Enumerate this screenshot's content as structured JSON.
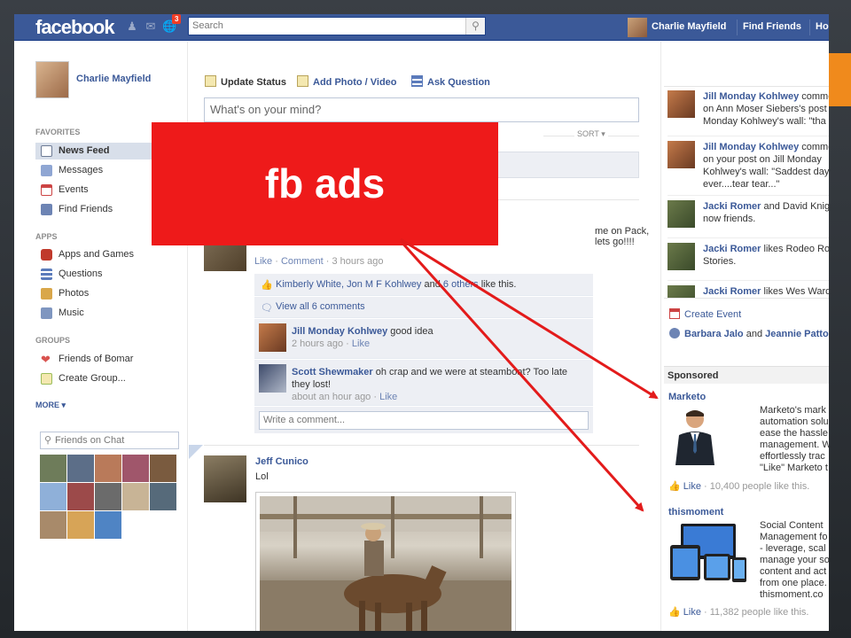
{
  "header": {
    "logo": "facebook",
    "notification_count": "3",
    "search_placeholder": "Search",
    "user_name": "Charlie Mayfield",
    "find_friends": "Find Friends",
    "home_partial": "Ho"
  },
  "left": {
    "profile_name": "Charlie Mayfield",
    "favorites_title": "FAVORITES",
    "favorites": [
      {
        "label": "News Feed",
        "icon": "news-feed-icon"
      },
      {
        "label": "Messages",
        "icon": "messages-icon"
      },
      {
        "label": "Events",
        "icon": "events-icon"
      },
      {
        "label": "Find Friends",
        "icon": "find-friends-icon"
      }
    ],
    "apps_title": "APPS",
    "apps": [
      {
        "label": "Apps and Games",
        "icon": "apps-icon"
      },
      {
        "label": "Questions",
        "icon": "questions-icon"
      },
      {
        "label": "Photos",
        "icon": "photos-icon"
      },
      {
        "label": "Music",
        "icon": "music-icon"
      }
    ],
    "groups_title": "GROUPS",
    "groups": [
      {
        "label": "Friends of Bomar",
        "icon": "heart-icon"
      },
      {
        "label": "Create Group...",
        "icon": "create-group-icon"
      }
    ],
    "more": "MORE",
    "chat_placeholder": "Friends on Chat"
  },
  "composer": {
    "update_status": "Update Status",
    "add_photo": "Add Photo / Video",
    "ask_question": "Ask Question",
    "placeholder": "What's on your mind?",
    "sort": "SORT"
  },
  "post1": {
    "text_tail": "me on Pack, lets go!!!!",
    "like": "Like",
    "comment": "Comment",
    "time": "3 hours ago",
    "likes_line": {
      "names": "Kimberly White, Jon M F Kohlwey",
      "and": "and",
      "others": "6 others",
      "suffix": "like this."
    },
    "view_comments": "View all 6 comments",
    "comments": [
      {
        "name": "Jill Monday Kohlwey",
        "text": "good idea",
        "time": "2 hours ago",
        "like": "Like"
      },
      {
        "name": "Scott Shewmaker",
        "text": "oh crap and we were at steamboat? Too late they lost!",
        "time": "about an hour ago",
        "like": "Like"
      }
    ],
    "write_placeholder": "Write a comment..."
  },
  "post2": {
    "name": "Jeff Cunico",
    "text": "Lol"
  },
  "ticker": [
    {
      "name": "Jill Monday Kohlwey",
      "rest": "comme",
      "line2": "on Ann Moser Siebers's post",
      "line3": "Monday Kohlwey's wall: \"tha"
    },
    {
      "name": "Jill Monday Kohlwey",
      "rest": "comme",
      "line2": "on your post on Jill Monday",
      "line3": "Kohlwey's wall: \"Saddest day",
      "line4": "ever....tear tear...\""
    },
    {
      "name": "Jacki Romer",
      "rest": "and David Knig",
      "line2": "now friends.",
      "line3": ""
    },
    {
      "name": "Jacki Romer",
      "rest": "likes Rodeo Roa",
      "line2": "Stories.",
      "line3": ""
    },
    {
      "name": "Jacki Romer",
      "rest": "likes Wes Ward",
      "line2": "",
      "line3": ""
    }
  ],
  "events": {
    "create_event": "Create Event",
    "birthday_a": "Barbara Jalo",
    "and": "and",
    "birthday_b": "Jeannie Patto"
  },
  "ads": {
    "sponsored": "Sponsored",
    "items": [
      {
        "title": "Marketo",
        "lines": [
          "Marketo's mark",
          "automation solu",
          "ease the hassle",
          "management. W",
          "effortlessly trac",
          "\"Like\" Marketo t"
        ],
        "like": "Like",
        "count": "10,400 people like this."
      },
      {
        "title": "thismoment",
        "lines": [
          "Social Content",
          "Management fo",
          "- leverage, scal",
          "manage your so",
          "content and act",
          "from one place.",
          "thismoment.co"
        ],
        "like": "Like",
        "count": "11,382 people like this."
      }
    ]
  },
  "overlay": {
    "banner_text": "fb ads",
    "banner_color": "#ee1a1a",
    "arrow_color": "#e31b1b"
  },
  "colors": {
    "brand": "#3b5998",
    "slide_accent": "#f08a1c"
  }
}
